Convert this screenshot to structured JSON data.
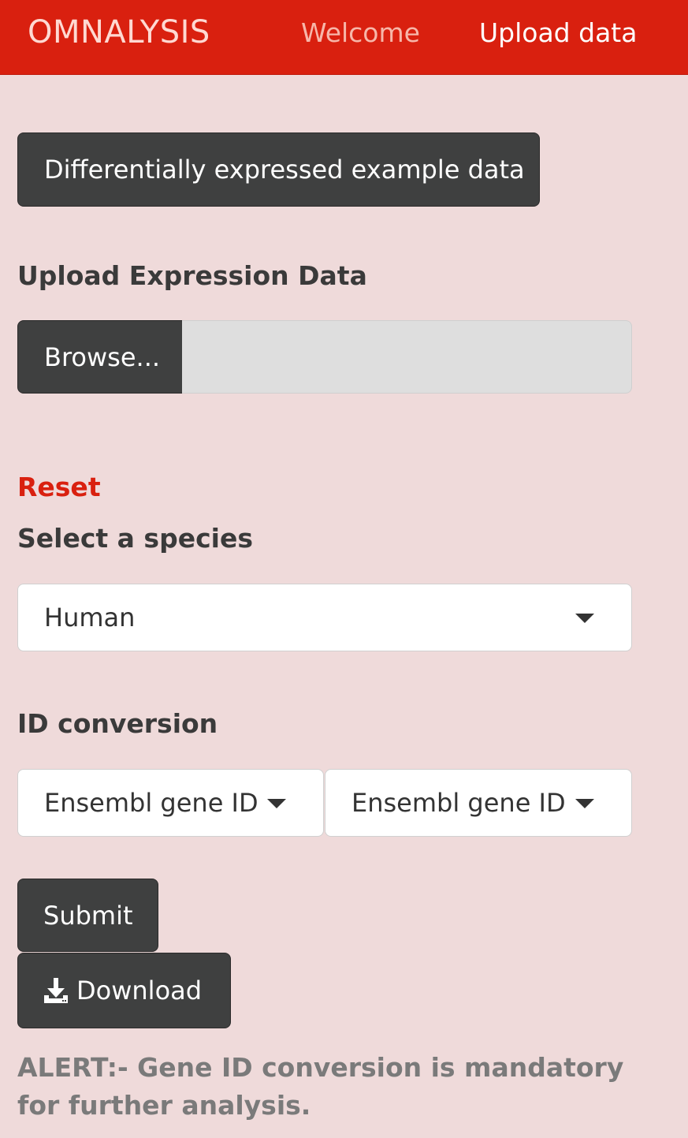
{
  "navbar": {
    "brand": "OMNALYSIS",
    "links": [
      "Welcome",
      "Upload data"
    ]
  },
  "example_button": "Differentially expressed example data",
  "upload": {
    "label": "Upload Expression Data",
    "browse_label": "Browse..."
  },
  "reset_label": "Reset",
  "species": {
    "label": "Select a species",
    "selected": "Human"
  },
  "id_conversion": {
    "label": "ID conversion",
    "from_selected": "Ensembl gene ID",
    "to_selected": "Ensembl gene ID"
  },
  "submit_label": "Submit",
  "download_label": "Download",
  "alert_text": "ALERT:- Gene ID conversion is mandatory for further analysis.",
  "colors": {
    "navbar": "#d9200f",
    "background": "#efdada",
    "button": "#3f4040",
    "accent": "#d9200f"
  },
  "icons": {
    "download": "download-icon",
    "dropdown": "caret-down-icon"
  }
}
